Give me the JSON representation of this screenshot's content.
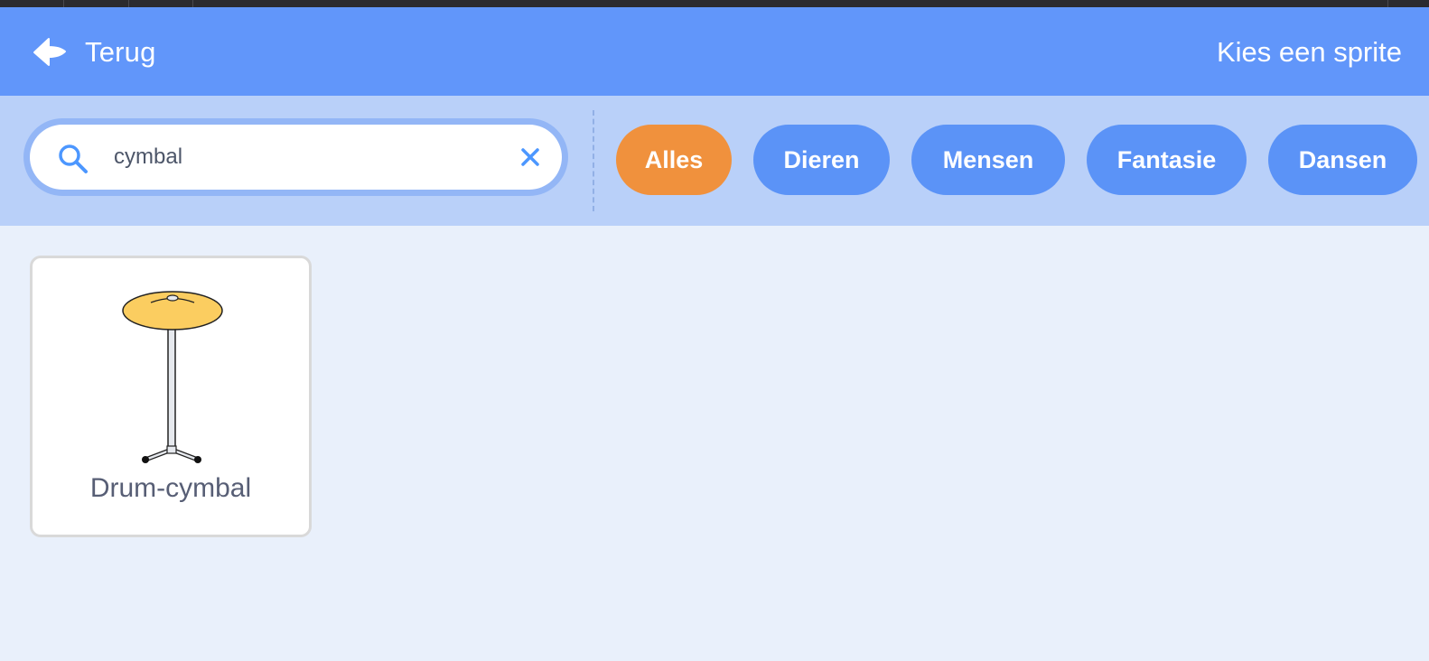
{
  "header": {
    "back_label": "Terug",
    "title": "Kies een sprite"
  },
  "search": {
    "value": "cymbal",
    "placeholder": ""
  },
  "categories": [
    {
      "label": "Alles",
      "active": true
    },
    {
      "label": "Dieren",
      "active": false
    },
    {
      "label": "Mensen",
      "active": false
    },
    {
      "label": "Fantasie",
      "active": false
    },
    {
      "label": "Dansen",
      "active": false
    }
  ],
  "sprites": [
    {
      "name": "Drum-cymbal"
    }
  ],
  "colors": {
    "header_bg": "#6196fa",
    "filterbar_bg": "#b9d0f9",
    "active_pill": "#f0913d",
    "pill": "#5b93f7",
    "content_bg": "#e9f0fb"
  },
  "icons": {
    "back": "back-arrow-icon",
    "search": "search-icon",
    "clear": "close-icon"
  }
}
